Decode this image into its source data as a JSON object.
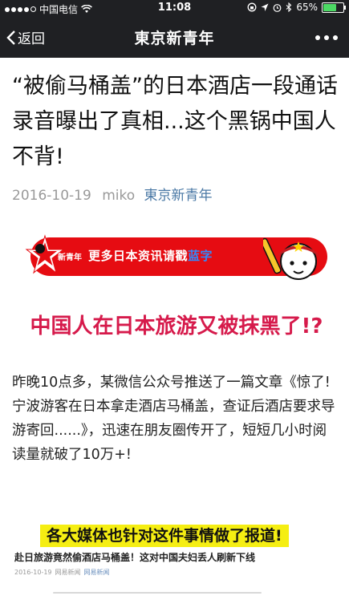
{
  "status_bar": {
    "carrier": "中国电信",
    "time": "11:08",
    "battery_text": "65%",
    "battery_level": 0.65,
    "icons": [
      "signal-icon",
      "wifi-icon",
      "rotation-lock-icon",
      "location-icon",
      "alarm-icon",
      "bluetooth-icon",
      "battery-icon"
    ]
  },
  "nav": {
    "back_label": "返回",
    "title": "東京新青年"
  },
  "article": {
    "title": "“被偷马桶盖”的日本酒店一段通话录音曝出了真相...这个黑锅中国人不背!",
    "date": "2016-10-19",
    "author": "miko",
    "account": "東京新青年"
  },
  "banner": {
    "logo_text": "新青年",
    "text_prefix": "更多日本资讯请戳",
    "text_highlight": "蓝字",
    "colors": {
      "background": "#e60c12",
      "highlight": "#2f8bff"
    }
  },
  "headline": "中国人在日本旅游又被抹黑了!?",
  "body": "昨晚10点多，某微信公众号推送了一篇文章《惊了!宁波游客在日本拿走酒店马桶盖，查证后酒店要求导游寄回......》，迅速在朋友圈传开了，短短几小时阅读量就破了10万+!",
  "embed": {
    "highlight": "各大媒体也针对这件事情做了报道!",
    "headline": "赴日旅游竟然偷酒店马桶盖！这对中国夫妇丢人刷新下线",
    "date": "2016-10-19",
    "source": "网易新闻",
    "source2": "网易新闻"
  }
}
